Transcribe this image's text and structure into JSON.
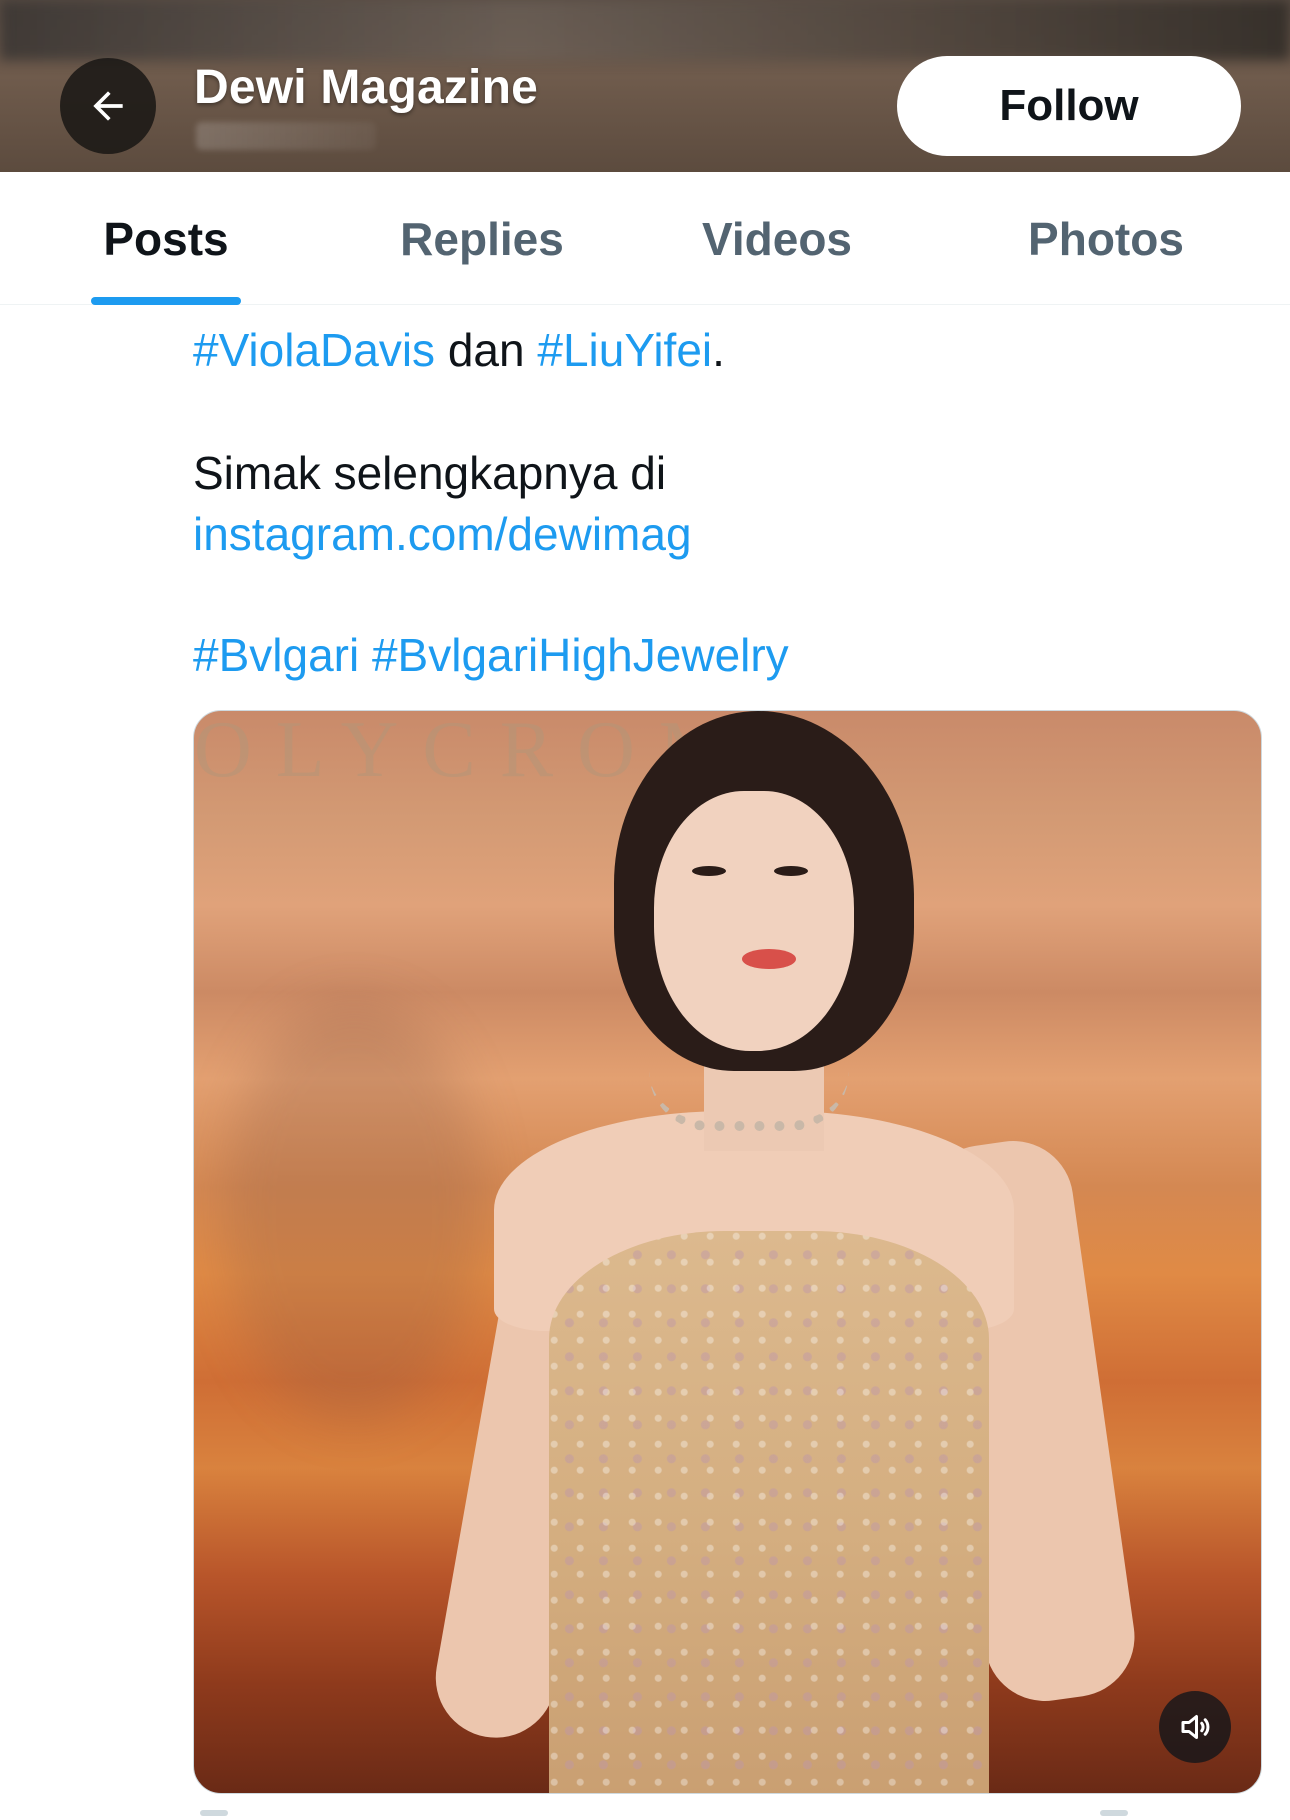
{
  "header": {
    "title": "Dewi Magazine",
    "back_icon": "arrow-left-icon",
    "follow_label": "Follow"
  },
  "tabs": [
    {
      "label": "Posts",
      "active": true
    },
    {
      "label": "Replies",
      "active": false
    },
    {
      "label": "Videos",
      "active": false
    },
    {
      "label": "Photos",
      "active": false
    }
  ],
  "post": {
    "line1": {
      "hashtag1": "#ViolaDavis",
      "connector": " dan ",
      "hashtag2": "#LiuYifei",
      "end": "."
    },
    "line2": "Simak selengkapnya di",
    "link": "instagram.com/dewimag",
    "hashtags": "#Bvlgari #BvlgariHighJewelry",
    "media": {
      "backdrop_text": "OLYCROMA",
      "sound_icon": "speaker-muted-icon"
    }
  },
  "colors": {
    "accent": "#1d9bf0",
    "text": "#0f1419",
    "muted": "#536471"
  }
}
